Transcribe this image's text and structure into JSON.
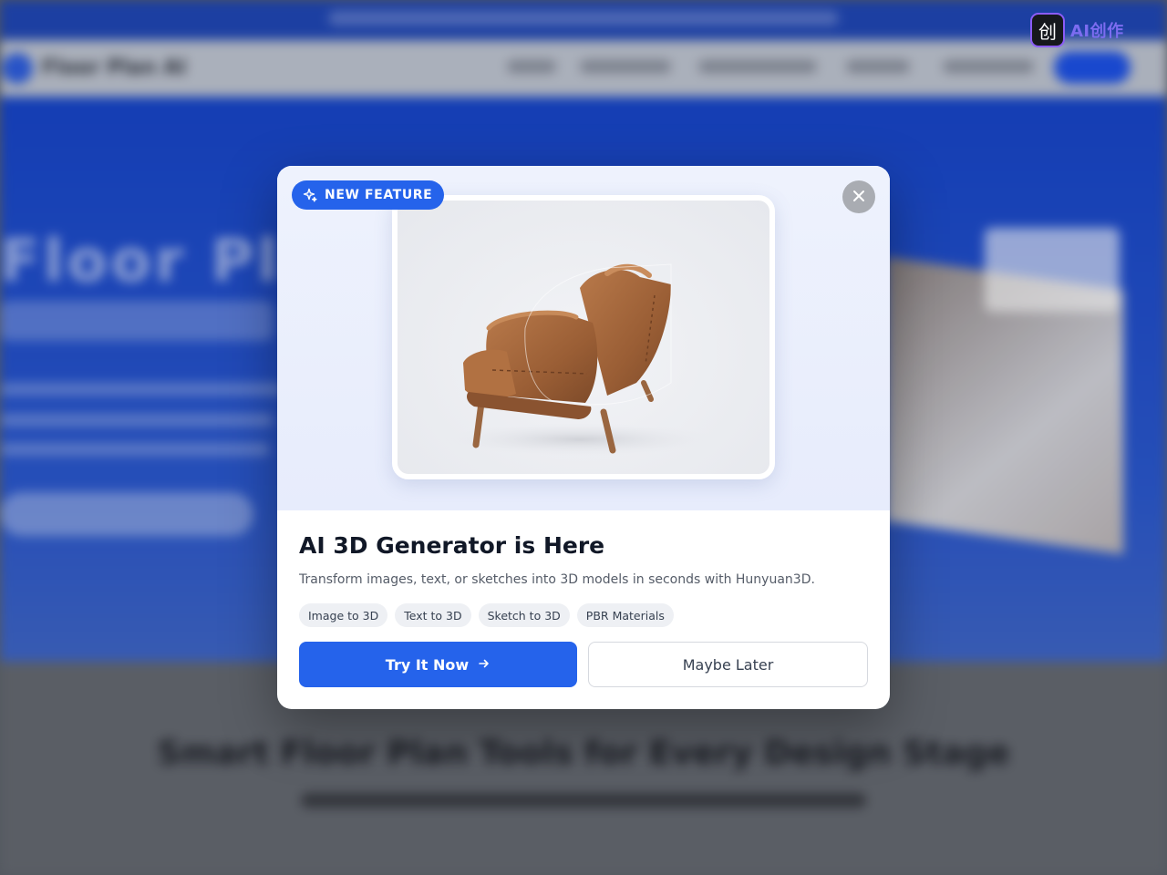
{
  "background_page": {
    "logo_text": "Floor Plan AI",
    "hero_title": "Floor Plan",
    "section_title": "Smart Floor Plan Tools for Every Design Stage"
  },
  "watermark": {
    "mark": "创",
    "text": "AI创作"
  },
  "modal": {
    "badge": {
      "label": "NEW FEATURE",
      "icon": "sparkle-icon"
    },
    "close": {
      "icon": "close-icon"
    },
    "preview": {
      "subject": "leather-armchair"
    },
    "title": "AI 3D Generator is Here",
    "description": "Transform images, text, or sketches into 3D models in seconds with Hunyuan3D.",
    "tags": [
      "Image to 3D",
      "Text to 3D",
      "Sketch to 3D",
      "PBR Materials"
    ],
    "primary_button": {
      "label": "Try It Now",
      "icon": "arrow-right-icon"
    },
    "secondary_button": {
      "label": "Maybe Later"
    },
    "colors": {
      "accent": "#2563eb",
      "hero_bg": "#e9eefc",
      "close_bg": "#a9acb2"
    }
  }
}
